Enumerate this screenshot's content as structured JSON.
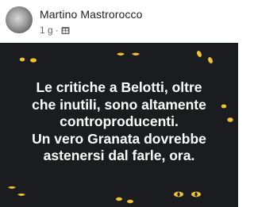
{
  "post": {
    "author": "Martino Mastrorocco",
    "time": "1 g",
    "separator": "·",
    "audience_icon": "friends-icon",
    "text": "Le critiche a Belotti, oltre\nche inutili, sono altamente\ncontroproducenti.\nUn vero Granata dovrebbe\nastenersi dal farle, ora.",
    "background_style": "dark-eyes",
    "colors": {
      "background": "#1b1c20",
      "text": "#ffffff",
      "eyes": "#f2c230",
      "author": "#1c1e21",
      "meta": "#65676b"
    }
  }
}
